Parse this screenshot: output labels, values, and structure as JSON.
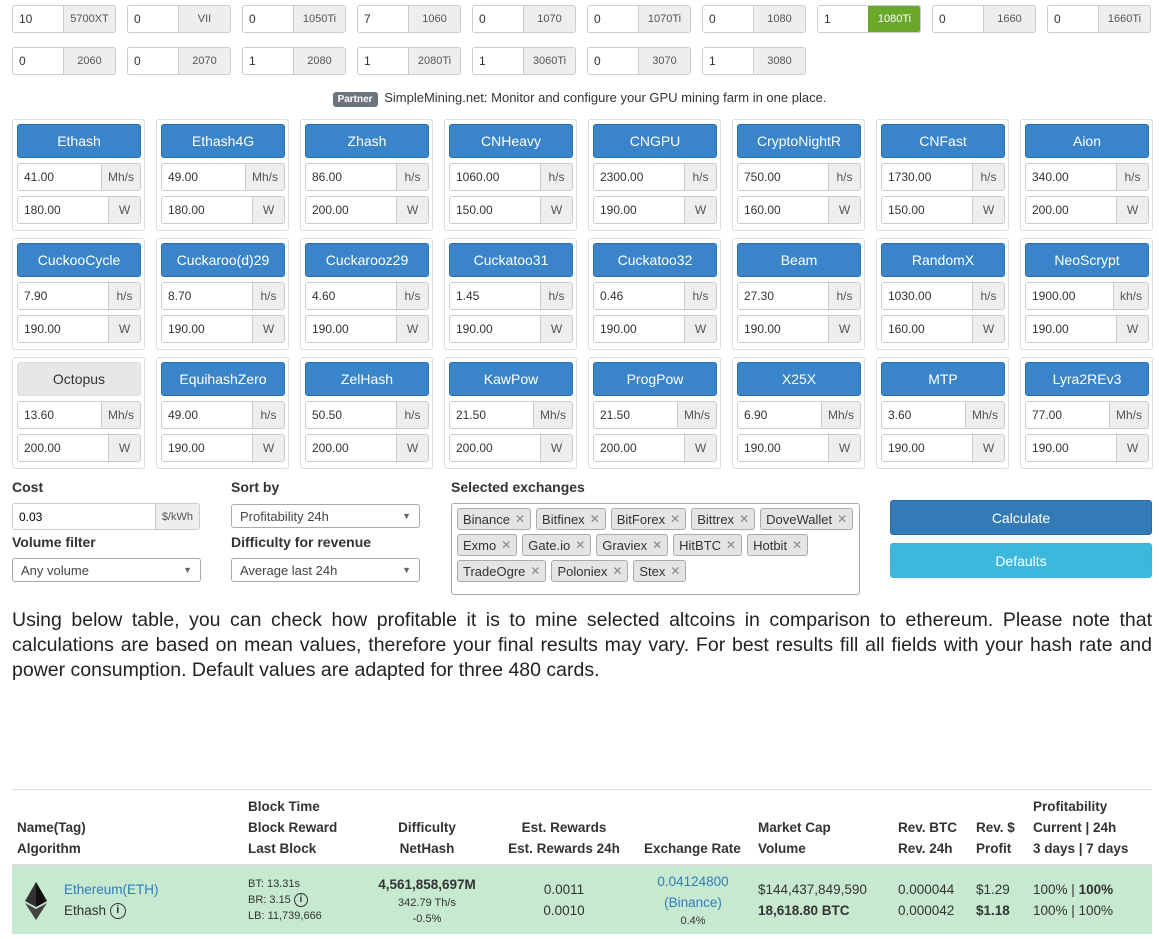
{
  "gpus": [
    {
      "qty": "10",
      "model": "5700XT",
      "selected": false
    },
    {
      "qty": "0",
      "model": "VII",
      "selected": false
    },
    {
      "qty": "0",
      "model": "1050Ti",
      "selected": false
    },
    {
      "qty": "7",
      "model": "1060",
      "selected": false
    },
    {
      "qty": "0",
      "model": "1070",
      "selected": false
    },
    {
      "qty": "0",
      "model": "1070Ti",
      "selected": false
    },
    {
      "qty": "0",
      "model": "1080",
      "selected": false
    },
    {
      "qty": "1",
      "model": "1080Ti",
      "selected": true
    },
    {
      "qty": "0",
      "model": "1660",
      "selected": false
    },
    {
      "qty": "0",
      "model": "1660Ti",
      "selected": false
    },
    {
      "qty": "0",
      "model": "2060",
      "selected": false
    },
    {
      "qty": "0",
      "model": "2070",
      "selected": false
    },
    {
      "qty": "1",
      "model": "2080",
      "selected": false
    },
    {
      "qty": "1",
      "model": "2080Ti",
      "selected": false
    },
    {
      "qty": "1",
      "model": "3060Ti",
      "selected": false
    },
    {
      "qty": "0",
      "model": "3070",
      "selected": false
    },
    {
      "qty": "1",
      "model": "3080",
      "selected": false
    }
  ],
  "partner": {
    "badge": "Partner",
    "text": "SimpleMining.net: Monitor and configure your GPU mining farm in one place."
  },
  "algorithms": [
    {
      "name": "Ethash",
      "active": true,
      "hashrate": "41.00",
      "hash_unit": "Mh/s",
      "power": "180.00",
      "power_unit": "W"
    },
    {
      "name": "Ethash4G",
      "active": true,
      "hashrate": "49.00",
      "hash_unit": "Mh/s",
      "power": "180.00",
      "power_unit": "W"
    },
    {
      "name": "Zhash",
      "active": true,
      "hashrate": "86.00",
      "hash_unit": "h/s",
      "power": "200.00",
      "power_unit": "W"
    },
    {
      "name": "CNHeavy",
      "active": true,
      "hashrate": "1060.00",
      "hash_unit": "h/s",
      "power": "150.00",
      "power_unit": "W"
    },
    {
      "name": "CNGPU",
      "active": true,
      "hashrate": "2300.00",
      "hash_unit": "h/s",
      "power": "190.00",
      "power_unit": "W"
    },
    {
      "name": "CryptoNightR",
      "active": true,
      "hashrate": "750.00",
      "hash_unit": "h/s",
      "power": "160.00",
      "power_unit": "W"
    },
    {
      "name": "CNFast",
      "active": true,
      "hashrate": "1730.00",
      "hash_unit": "h/s",
      "power": "150.00",
      "power_unit": "W"
    },
    {
      "name": "Aion",
      "active": true,
      "hashrate": "340.00",
      "hash_unit": "h/s",
      "power": "200.00",
      "power_unit": "W"
    },
    {
      "name": "CuckooCycle",
      "active": true,
      "hashrate": "7.90",
      "hash_unit": "h/s",
      "power": "190.00",
      "power_unit": "W"
    },
    {
      "name": "Cuckaroo(d)29",
      "active": true,
      "hashrate": "8.70",
      "hash_unit": "h/s",
      "power": "190.00",
      "power_unit": "W"
    },
    {
      "name": "Cuckarooz29",
      "active": true,
      "hashrate": "4.60",
      "hash_unit": "h/s",
      "power": "190.00",
      "power_unit": "W"
    },
    {
      "name": "Cuckatoo31",
      "active": true,
      "hashrate": "1.45",
      "hash_unit": "h/s",
      "power": "190.00",
      "power_unit": "W"
    },
    {
      "name": "Cuckatoo32",
      "active": true,
      "hashrate": "0.46",
      "hash_unit": "h/s",
      "power": "190.00",
      "power_unit": "W"
    },
    {
      "name": "Beam",
      "active": true,
      "hashrate": "27.30",
      "hash_unit": "h/s",
      "power": "190.00",
      "power_unit": "W"
    },
    {
      "name": "RandomX",
      "active": true,
      "hashrate": "1030.00",
      "hash_unit": "h/s",
      "power": "160.00",
      "power_unit": "W"
    },
    {
      "name": "NeoScrypt",
      "active": true,
      "hashrate": "1900.00",
      "hash_unit": "kh/s",
      "power": "190.00",
      "power_unit": "W"
    },
    {
      "name": "Octopus",
      "active": false,
      "hashrate": "13.60",
      "hash_unit": "Mh/s",
      "power": "200.00",
      "power_unit": "W"
    },
    {
      "name": "EquihashZero",
      "active": true,
      "hashrate": "49.00",
      "hash_unit": "h/s",
      "power": "190.00",
      "power_unit": "W"
    },
    {
      "name": "ZelHash",
      "active": true,
      "hashrate": "50.50",
      "hash_unit": "h/s",
      "power": "200.00",
      "power_unit": "W"
    },
    {
      "name": "KawPow",
      "active": true,
      "hashrate": "21.50",
      "hash_unit": "Mh/s",
      "power": "200.00",
      "power_unit": "W"
    },
    {
      "name": "ProgPow",
      "active": true,
      "hashrate": "21.50",
      "hash_unit": "Mh/s",
      "power": "200.00",
      "power_unit": "W"
    },
    {
      "name": "X25X",
      "active": true,
      "hashrate": "6.90",
      "hash_unit": "Mh/s",
      "power": "190.00",
      "power_unit": "W"
    },
    {
      "name": "MTP",
      "active": true,
      "hashrate": "3.60",
      "hash_unit": "Mh/s",
      "power": "190.00",
      "power_unit": "W"
    },
    {
      "name": "Lyra2REv3",
      "active": true,
      "hashrate": "77.00",
      "hash_unit": "Mh/s",
      "power": "190.00",
      "power_unit": "W"
    }
  ],
  "settings": {
    "cost_label": "Cost",
    "cost_value": "0.03",
    "cost_unit": "$/kWh",
    "volume_label": "Volume filter",
    "volume_value": "Any volume",
    "sort_label": "Sort by",
    "sort_value": "Profitability 24h",
    "difficulty_label": "Difficulty for revenue",
    "difficulty_value": "Average last 24h",
    "exchanges_label": "Selected exchanges",
    "exchanges": [
      "Binance",
      "Bitfinex",
      "BitForex",
      "Bittrex",
      "DoveWallet",
      "Exmo",
      "Gate.io",
      "Graviex",
      "HitBTC",
      "Hotbit",
      "TradeOgre",
      "Poloniex",
      "Stex"
    ],
    "calculate_label": "Calculate",
    "defaults_label": "Defaults"
  },
  "intro_text": "Using below table, you can check how profitable it is to mine selected altcoins in comparison to ethereum. Please note that calculations are based on mean values, therefore your final results may vary. For best results fill all fields with your hash rate and power consumption. Default values are adapted for three 480 cards.",
  "table": {
    "headers": {
      "name_1": "Name(Tag)",
      "name_2": "Algorithm",
      "block_1": "Block Time",
      "block_2": "Block Reward",
      "block_3": "Last Block",
      "diff_1": "Difficulty",
      "diff_2": "NetHash",
      "rewards_1": "Est. Rewards",
      "rewards_2": "Est. Rewards 24h",
      "rate": "Exchange Rate",
      "mcap_1": "Market Cap",
      "mcap_2": "Volume",
      "revbtc_1": "Rev. BTC",
      "revbtc_2": "Rev. 24h",
      "revusd_1": "Rev. $",
      "revusd_2": "Profit",
      "prof_1": "Profitability",
      "prof_2": "Current | 24h",
      "prof_3": "3 days | 7 days"
    },
    "row": {
      "coin": "Ethereum(ETH)",
      "algorithm": "Ethash",
      "block_time": "BT: 13.31s",
      "block_reward": "BR: 3.15",
      "last_block": "LB: 11,739,666",
      "difficulty": "4,561,858,697M",
      "nethash": "342.79 Th/s",
      "diff_change": "-0.5%",
      "est_rewards": "0.0011",
      "est_rewards_24h": "0.0010",
      "exchange_rate": "0.04124800",
      "exchange": "(Binance)",
      "rate_change": "0.4%",
      "market_cap": "$144,437,849,590",
      "volume": "18,618.80 BTC",
      "rev_btc": "0.000044",
      "rev_24h": "0.000042",
      "rev_usd": "$1.29",
      "profit": "$1.18",
      "prof_current": "100% |",
      "prof_24h": "100%",
      "prof_3d7d": "100% | 100%"
    }
  }
}
